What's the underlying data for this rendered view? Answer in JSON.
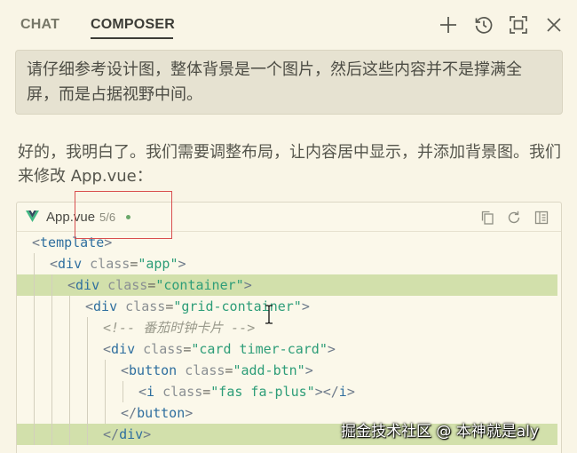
{
  "header": {
    "tabs": [
      {
        "label": "CHAT",
        "active": false
      },
      {
        "label": "COMPOSER",
        "active": true
      }
    ],
    "actions": [
      "plus-icon",
      "history-icon",
      "maximize-icon",
      "close-icon"
    ]
  },
  "user_message": {
    "text": "请仔细参考设计图，整体背景是一个图片，然后这些内容并不是撑满全屏，而是占据视野中间。"
  },
  "assistant_message": {
    "text": "好的，我明白了。我们需要调整布局，让内容居中显示，并添加背景图。我们来修改 App.vue："
  },
  "code_block": {
    "file_name": "App.vue",
    "change_count": "5/6",
    "actions": [
      "copy-icon",
      "refresh-icon",
      "open-file-icon"
    ],
    "lines": [
      {
        "added": false,
        "parts": [
          {
            "c": "tk-bracket",
            "t": "<"
          },
          {
            "c": "tk-tag",
            "t": "template"
          },
          {
            "c": "tk-bracket",
            "t": ">"
          }
        ]
      },
      {
        "added": false,
        "parts": [
          {
            "c": "tk-bracket",
            "t": "<"
          },
          {
            "c": "tk-tag",
            "t": "div"
          },
          {
            "c": "tk-attr",
            "t": " class"
          },
          {
            "c": "tk-eq",
            "t": "="
          },
          {
            "c": "tk-str",
            "t": "\"app\""
          },
          {
            "c": "tk-bracket",
            "t": ">"
          }
        ]
      },
      {
        "added": true,
        "parts": [
          {
            "c": "tk-bracket",
            "t": "<"
          },
          {
            "c": "tk-tag",
            "t": "div"
          },
          {
            "c": "tk-attr",
            "t": " class"
          },
          {
            "c": "tk-eq",
            "t": "="
          },
          {
            "c": "tk-str",
            "t": "\"container\""
          },
          {
            "c": "tk-bracket",
            "t": ">"
          }
        ]
      },
      {
        "added": false,
        "parts": [
          {
            "c": "tk-bracket",
            "t": "<"
          },
          {
            "c": "tk-tag",
            "t": "div"
          },
          {
            "c": "tk-attr",
            "t": " class"
          },
          {
            "c": "tk-eq",
            "t": "="
          },
          {
            "c": "tk-str",
            "t": "\"grid-container\""
          },
          {
            "c": "tk-bracket",
            "t": ">"
          }
        ]
      },
      {
        "added": false,
        "parts": [
          {
            "c": "tk-comment",
            "t": "<!-- 番茄时钟卡片 -->"
          }
        ]
      },
      {
        "added": false,
        "parts": [
          {
            "c": "tk-bracket",
            "t": "<"
          },
          {
            "c": "tk-tag",
            "t": "div"
          },
          {
            "c": "tk-attr",
            "t": " class"
          },
          {
            "c": "tk-eq",
            "t": "="
          },
          {
            "c": "tk-str",
            "t": "\"card timer-card\""
          },
          {
            "c": "tk-bracket",
            "t": ">"
          }
        ]
      },
      {
        "added": false,
        "parts": [
          {
            "c": "tk-bracket",
            "t": "<"
          },
          {
            "c": "tk-tag",
            "t": "button"
          },
          {
            "c": "tk-attr",
            "t": " class"
          },
          {
            "c": "tk-eq",
            "t": "="
          },
          {
            "c": "tk-str",
            "t": "\"add-btn\""
          },
          {
            "c": "tk-bracket",
            "t": ">"
          }
        ]
      },
      {
        "added": false,
        "parts": [
          {
            "c": "tk-bracket",
            "t": "<"
          },
          {
            "c": "tk-tag",
            "t": "i"
          },
          {
            "c": "tk-attr",
            "t": " class"
          },
          {
            "c": "tk-eq",
            "t": "="
          },
          {
            "c": "tk-str",
            "t": "\"fas fa-plus\""
          },
          {
            "c": "tk-bracket",
            "t": "></"
          },
          {
            "c": "tk-tag",
            "t": "i"
          },
          {
            "c": "tk-bracket",
            "t": ">"
          }
        ]
      },
      {
        "added": false,
        "parts": [
          {
            "c": "tk-bracket",
            "t": "</"
          },
          {
            "c": "tk-tag",
            "t": "button"
          },
          {
            "c": "tk-bracket",
            "t": ">"
          }
        ]
      },
      {
        "added": true,
        "parts": [
          {
            "c": "tk-bracket",
            "t": "</"
          },
          {
            "c": "tk-tag",
            "t": "div"
          },
          {
            "c": "tk-bracket",
            "t": ">"
          }
        ]
      }
    ]
  },
  "watermark": {
    "text": "掘金技术社区 @ 本神就是aly"
  },
  "colors": {
    "background": "#f9f5e6",
    "added_line": "#d2e0ab",
    "annotation": "#d94f4f",
    "string": "#2d9d78",
    "tag": "#2f6f9f"
  }
}
